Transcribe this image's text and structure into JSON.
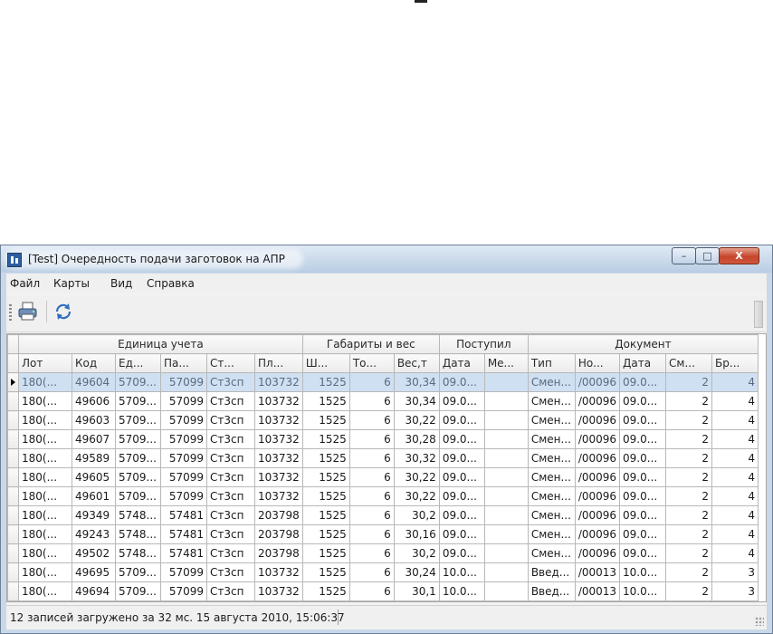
{
  "window": {
    "title": "[Test] Очередность подачи заготовок на АПР"
  },
  "controls": {
    "minimize": "–",
    "maximize": "□",
    "close": "X"
  },
  "menu": [
    "Файл",
    "Карты",
    "Вид",
    "Справка"
  ],
  "toolbar": {
    "icons": [
      "printer-icon",
      "refresh-icon"
    ]
  },
  "grid": {
    "groups": [
      "Единица учета",
      "Габариты и вес",
      "Поступил",
      "Документ"
    ],
    "columns": [
      "Лот",
      "Код",
      "Ед...",
      "Па...",
      "Ст...",
      "Пл...",
      "Ш...",
      "То...",
      "Вес,т",
      "Дата",
      "Ме...",
      "Тип",
      "Но...",
      "Дата",
      "См...",
      "Бр..."
    ],
    "rows": [
      [
        "180(...",
        "49604",
        "5709...",
        "57099",
        "Ст3сп",
        "103732",
        "1525",
        "6",
        "30,34",
        "09.0...",
        "",
        "Смен...",
        "/00096",
        "09.0...",
        "2",
        "4"
      ],
      [
        "180(...",
        "49606",
        "5709...",
        "57099",
        "Ст3сп",
        "103732",
        "1525",
        "6",
        "30,34",
        "09.0...",
        "",
        "Смен...",
        "/00096",
        "09.0...",
        "2",
        "4"
      ],
      [
        "180(...",
        "49603",
        "5709...",
        "57099",
        "Ст3сп",
        "103732",
        "1525",
        "6",
        "30,22",
        "09.0...",
        "",
        "Смен...",
        "/00096",
        "09.0...",
        "2",
        "4"
      ],
      [
        "180(...",
        "49607",
        "5709...",
        "57099",
        "Ст3сп",
        "103732",
        "1525",
        "6",
        "30,28",
        "09.0...",
        "",
        "Смен...",
        "/00096",
        "09.0...",
        "2",
        "4"
      ],
      [
        "180(...",
        "49589",
        "5709...",
        "57099",
        "Ст3сп",
        "103732",
        "1525",
        "6",
        "30,32",
        "09.0...",
        "",
        "Смен...",
        "/00096",
        "09.0...",
        "2",
        "4"
      ],
      [
        "180(...",
        "49605",
        "5709...",
        "57099",
        "Ст3сп",
        "103732",
        "1525",
        "6",
        "30,22",
        "09.0...",
        "",
        "Смен...",
        "/00096",
        "09.0...",
        "2",
        "4"
      ],
      [
        "180(...",
        "49601",
        "5709...",
        "57099",
        "Ст3сп",
        "103732",
        "1525",
        "6",
        "30,22",
        "09.0...",
        "",
        "Смен...",
        "/00096",
        "09.0...",
        "2",
        "4"
      ],
      [
        "180(...",
        "49349",
        "5748...",
        "57481",
        "Ст3сп",
        "203798",
        "1525",
        "6",
        "30,2",
        "09.0...",
        "",
        "Смен...",
        "/00096",
        "09.0...",
        "2",
        "4"
      ],
      [
        "180(...",
        "49243",
        "5748...",
        "57481",
        "Ст3сп",
        "203798",
        "1525",
        "6",
        "30,16",
        "09.0...",
        "",
        "Смен...",
        "/00096",
        "09.0...",
        "2",
        "4"
      ],
      [
        "180(...",
        "49502",
        "5748...",
        "57481",
        "Ст3сп",
        "203798",
        "1525",
        "6",
        "30,2",
        "09.0...",
        "",
        "Смен...",
        "/00096",
        "09.0...",
        "2",
        "4"
      ],
      [
        "180(...",
        "49695",
        "5709...",
        "57099",
        "Ст3сп",
        "103732",
        "1525",
        "6",
        "30,24",
        "10.0...",
        "",
        "Введ...",
        "/00013",
        "10.0...",
        "2",
        "3"
      ],
      [
        "180(...",
        "49694",
        "5709...",
        "57099",
        "Ст3сп",
        "103732",
        "1525",
        "6",
        "30,1",
        "10.0...",
        "",
        "Введ...",
        "/00013",
        "10.0...",
        "2",
        "3"
      ]
    ],
    "selected_row": 0
  },
  "status": {
    "text": "12 записей загружено за 32 мс. 15 августа 2010, 15:06:37"
  },
  "colors": {
    "selection": "#cfe0f2",
    "titlebar": "#c9d8e8",
    "close_button": "#c4452b"
  }
}
